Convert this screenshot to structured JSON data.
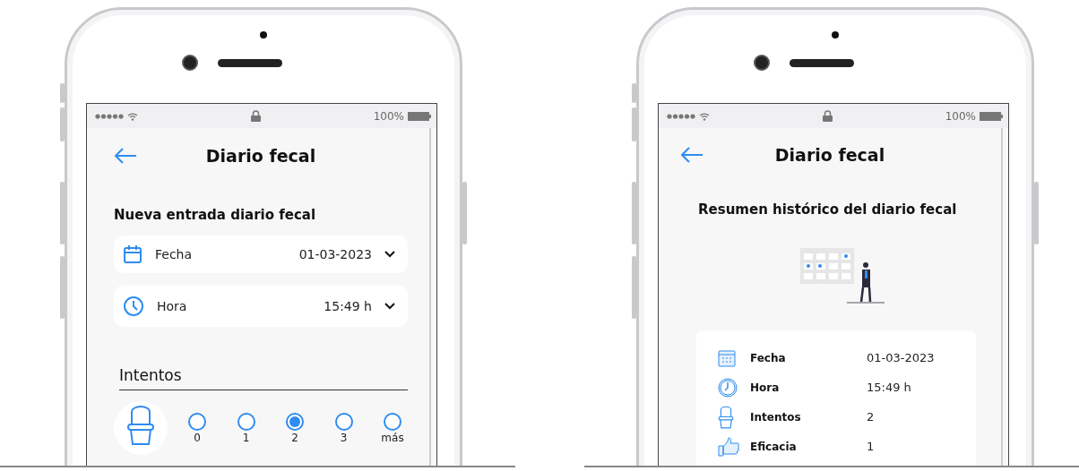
{
  "phones": [
    {
      "kind": "entry_form",
      "status_bar": {
        "battery": "100%"
      },
      "title": "Diario fecal",
      "section_title": "Nueva entrada diario fecal",
      "fields": [
        {
          "label": "Fecha",
          "value": "01-03-2023"
        },
        {
          "label": "Hora",
          "value": "15:49 h"
        }
      ],
      "attempts": {
        "title": "Intentos",
        "options": [
          {
            "label": "0",
            "selected": false
          },
          {
            "label": "1",
            "selected": false
          },
          {
            "label": "2",
            "selected": true
          },
          {
            "label": "3",
            "selected": false
          },
          {
            "label": "más",
            "selected": false
          }
        ]
      }
    },
    {
      "kind": "summary",
      "status_bar": {
        "battery": "100%"
      },
      "title": "Diario fecal",
      "section_title": "Resumen histórico del diario fecal",
      "rows": [
        {
          "label": "Fecha",
          "value": "01-03-2023"
        },
        {
          "label": "Hora",
          "value": "15:49 h"
        },
        {
          "label": "Intentos",
          "value": "2"
        },
        {
          "label": "Eficacia",
          "value": "1"
        }
      ]
    }
  ]
}
